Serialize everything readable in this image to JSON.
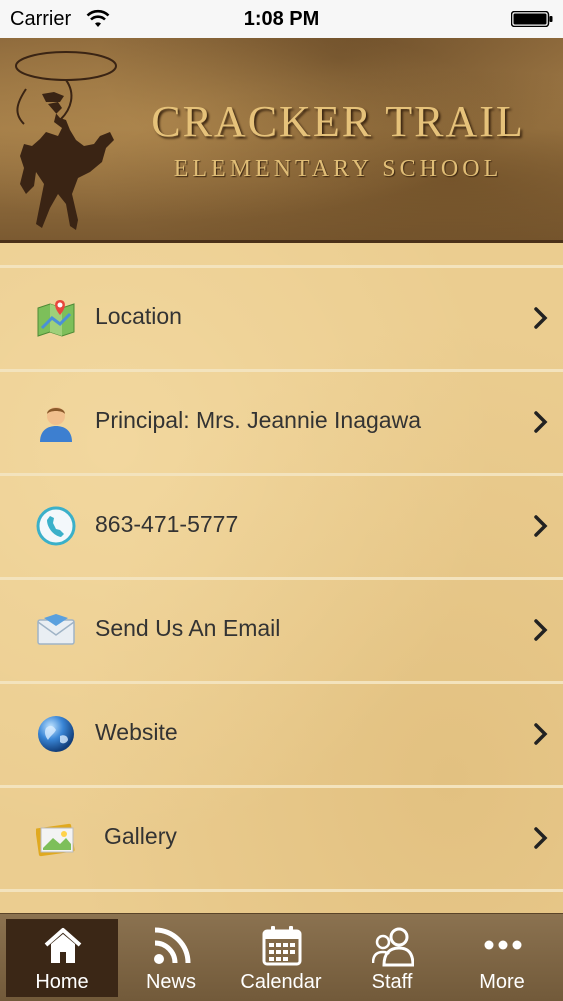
{
  "status_bar": {
    "carrier": "Carrier",
    "time": "1:08 PM"
  },
  "header": {
    "title": "CRACKER TRAIL",
    "subtitle": "ELEMENTARY SCHOOL"
  },
  "menu": {
    "items": [
      {
        "label": "Location",
        "icon": "map-icon"
      },
      {
        "label": "Principal: Mrs. Jeannie Inagawa",
        "icon": "person-icon"
      },
      {
        "label": "863-471-5777",
        "icon": "phone-icon"
      },
      {
        "label": "Send Us An Email",
        "icon": "email-icon"
      },
      {
        "label": "Website",
        "icon": "globe-icon"
      },
      {
        "label": "Gallery",
        "icon": "gallery-icon"
      }
    ]
  },
  "tabs": [
    {
      "label": "Home",
      "icon": "home-icon",
      "active": true
    },
    {
      "label": "News",
      "icon": "rss-icon"
    },
    {
      "label": "Calendar",
      "icon": "calendar-icon"
    },
    {
      "label": "Staff",
      "icon": "people-icon"
    },
    {
      "label": "More",
      "icon": "more-dots-icon"
    }
  ],
  "colors": {
    "menu_background": "#ebcd90",
    "tabbar": "#7d6444",
    "active_tab": "#3b2716",
    "title_gold": "#e6c27a"
  }
}
